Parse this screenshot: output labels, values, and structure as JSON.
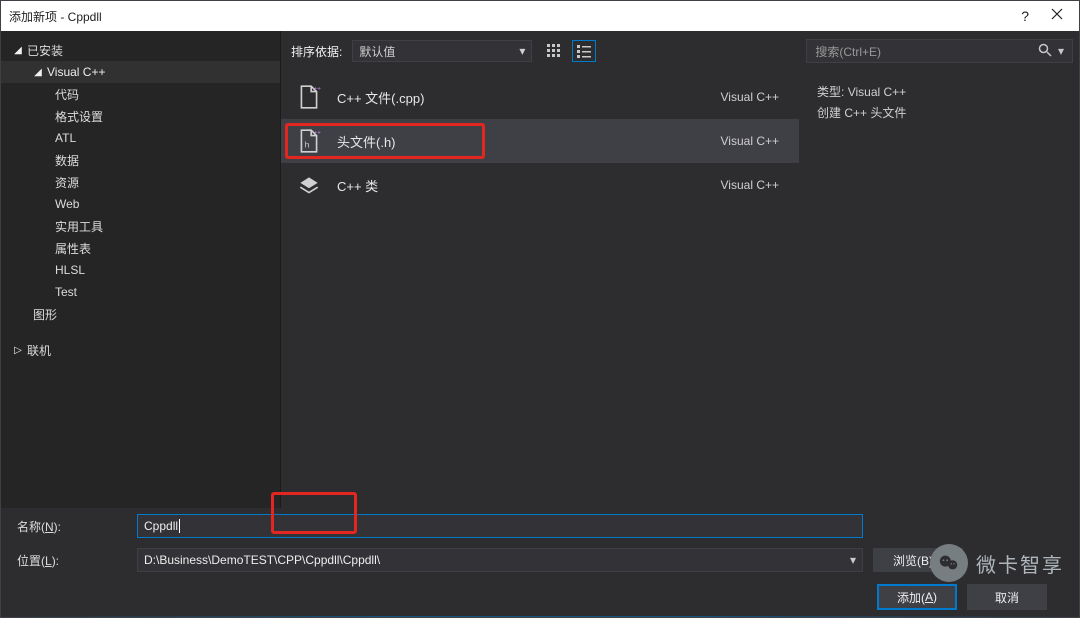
{
  "titlebar": {
    "title": "添加新项 - Cppdll",
    "help": "?",
    "close": "×"
  },
  "sidebar": {
    "installed": "已安装",
    "items": [
      {
        "label": "Visual C++",
        "expanded": true,
        "children": [
          {
            "label": "代码"
          },
          {
            "label": "格式设置"
          },
          {
            "label": "ATL"
          },
          {
            "label": "数据"
          },
          {
            "label": "资源"
          },
          {
            "label": "Web"
          },
          {
            "label": "实用工具"
          },
          {
            "label": "属性表"
          },
          {
            "label": "HLSL"
          },
          {
            "label": "Test"
          }
        ]
      },
      {
        "label": "图形"
      }
    ],
    "online": "联机"
  },
  "sortbar": {
    "label": "排序依据:",
    "combo_value": "默认值",
    "search_placeholder": "搜索(Ctrl+E)"
  },
  "templates": [
    {
      "name": "C++ 文件(.cpp)",
      "lang": "Visual C++",
      "icon": "cpp"
    },
    {
      "name": "头文件(.h)",
      "lang": "Visual C++",
      "icon": "h",
      "selected": true,
      "highlighted": true
    },
    {
      "name": "C++ 类",
      "lang": "Visual C++",
      "icon": "class"
    }
  ],
  "details": {
    "type_label": "类型:",
    "type_value": "Visual C++",
    "desc": "创建 C++ 头文件"
  },
  "form": {
    "name_label_pre": "名称(",
    "name_label_key": "N",
    "name_label_post": "):",
    "name_value": "Cppdll",
    "loc_label_pre": "位置(",
    "loc_label_key": "L",
    "loc_label_post": "):",
    "loc_value": "D:\\Business\\DemoTEST\\CPP\\Cppdll\\Cppdll\\",
    "browse": "浏览(B)..."
  },
  "actions": {
    "add_pre": "添加(",
    "add_key": "A",
    "add_post": ")",
    "cancel": "取消"
  },
  "watermark": "微卡智享"
}
